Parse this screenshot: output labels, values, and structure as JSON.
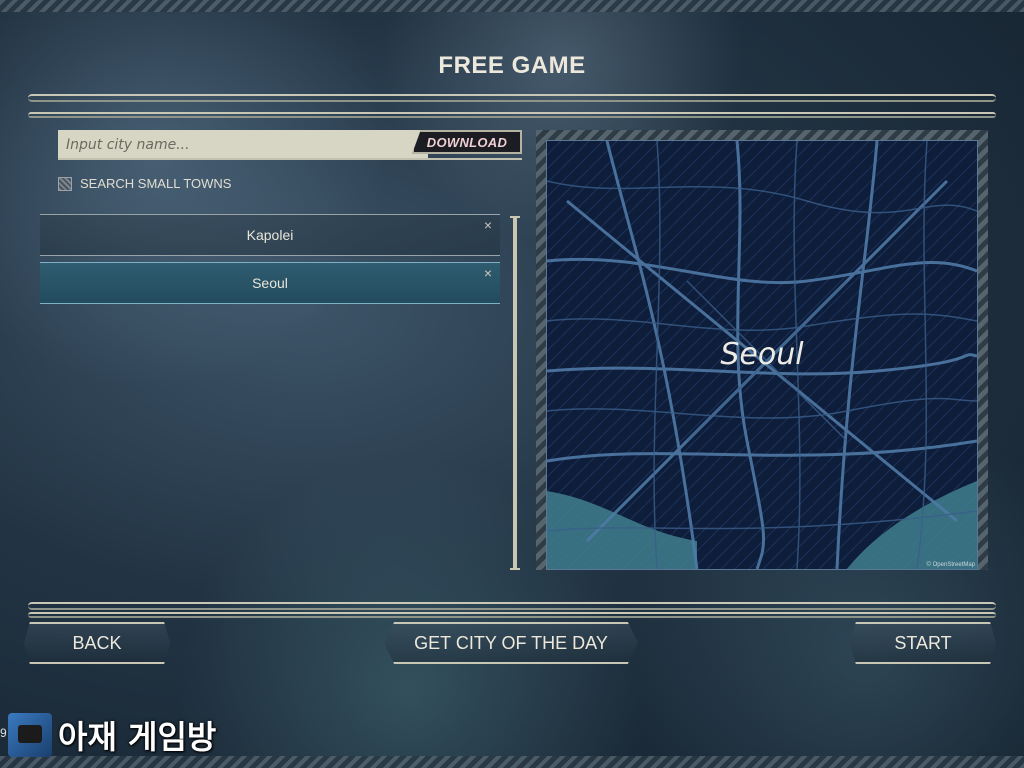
{
  "screen": {
    "title": "FREE GAME"
  },
  "search": {
    "placeholder": "Input city name...",
    "download_label": "DOWNLOAD",
    "small_towns_label": "SEARCH SMALL TOWNS",
    "small_towns_checked": false
  },
  "cities": [
    {
      "name": "Kapolei",
      "selected": false,
      "close": "×"
    },
    {
      "name": "Seoul",
      "selected": true,
      "close": "×"
    }
  ],
  "map": {
    "city_label": "Seoul",
    "credit": "© OpenStreetMap"
  },
  "buttons": {
    "back": "BACK",
    "city_of_day": "GET CITY OF THE DAY",
    "start": "START"
  },
  "overlay": {
    "watermark_text": "아재 게임방",
    "version_text": "9"
  },
  "colors": {
    "map_bg": "#0e1d3a",
    "map_roads": "#4f7aa6",
    "water": "#3f7f8f",
    "selected_row": "#2f5c70"
  }
}
